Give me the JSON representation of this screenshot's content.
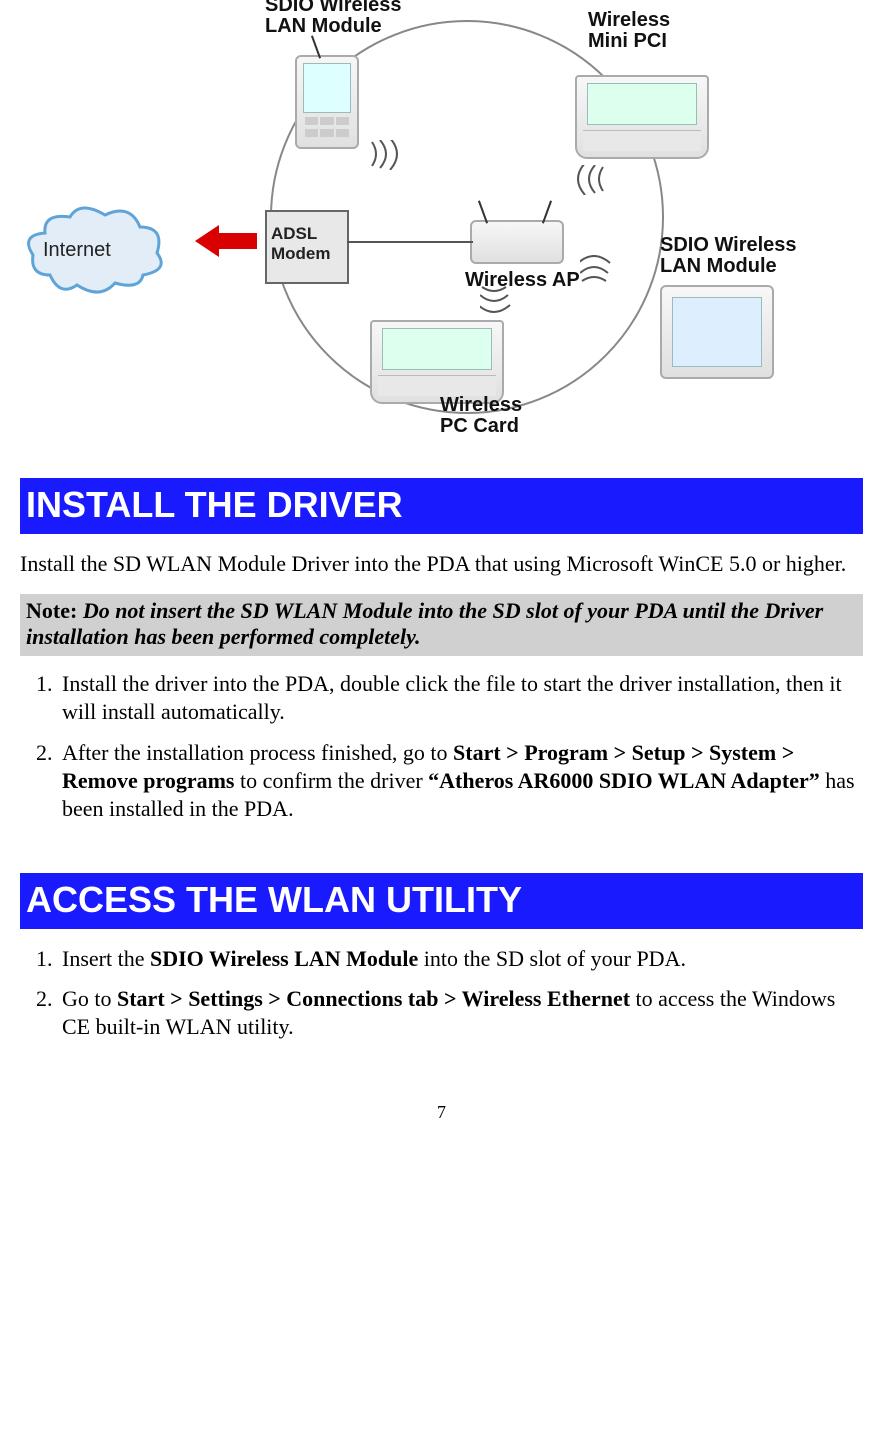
{
  "diagram": {
    "internet": "Internet",
    "adsl": "ADSL\nModem",
    "sdio1": "SDIO Wireless\nLAN Module",
    "minipci": "Wireless\nMini PCI",
    "ap": "Wireless AP",
    "sdio2": "SDIO Wireless\nLAN Module",
    "pccard": "Wireless\nPC Card"
  },
  "sections": {
    "install": {
      "heading": "INSTALL THE DRIVER",
      "intro": "Install the SD WLAN Module Driver into the PDA that using Microsoft WinCE 5.0 or higher.",
      "note_label": "Note:",
      "note_body": " Do not insert the SD WLAN Module into the SD slot of your PDA until the Driver installation has been performed completely.",
      "steps": {
        "s1": "Install the driver into the PDA, double click the file to start the driver installation, then it will install automatically.",
        "s2a": "After the installation process finished, go to ",
        "s2b": "Start > Program > Setup > System > Remove programs",
        "s2c": " to confirm the driver ",
        "s2d": "“Atheros AR6000 SDIO WLAN Adapter”",
        "s2e": " has been installed in the PDA."
      }
    },
    "access": {
      "heading": "ACCESS THE WLAN UTILITY",
      "steps": {
        "s1a": "Insert the ",
        "s1b": "SDIO Wireless LAN Module",
        "s1c": " into the SD slot of your PDA.",
        "s2a": "Go to ",
        "s2b": "Start > Settings > Connections tab > Wireless Ethernet",
        "s2c": " to access the Windows CE built-in WLAN utility."
      }
    }
  },
  "page_number": "7"
}
